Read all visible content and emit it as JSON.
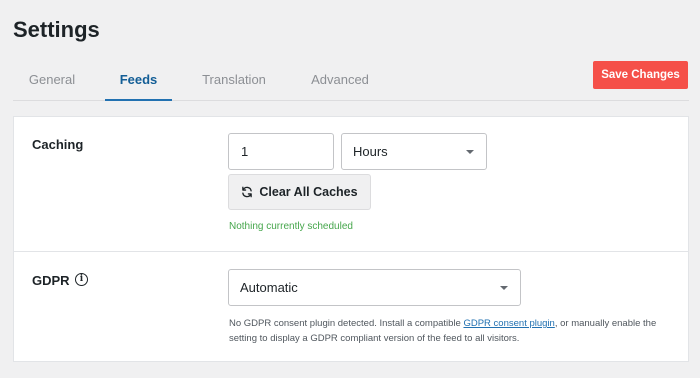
{
  "page": {
    "title": "Settings"
  },
  "tabs": [
    {
      "label": "General",
      "active": false
    },
    {
      "label": "Feeds",
      "active": true
    },
    {
      "label": "Translation",
      "active": false
    },
    {
      "label": "Advanced",
      "active": false
    }
  ],
  "header": {
    "save_label": "Save Changes"
  },
  "caching": {
    "label": "Caching",
    "interval_value": "1",
    "unit_selected": "Hours",
    "clear_button_label": "Clear All Caches",
    "status_text": "Nothing currently scheduled"
  },
  "gdpr": {
    "label": "GDPR",
    "info_icon_glyph": "i",
    "selected": "Automatic",
    "help_before": "No GDPR consent plugin detected. Install a compatible ",
    "help_link": "GDPR consent plugin",
    "help_after": ", or manually enable the setting to display a GDPR compliant version of the feed to all visitors."
  },
  "colors": {
    "accent": "#2271b1",
    "save_button": "#f55049",
    "status_green": "#46a64c",
    "background": "#f0f0f1"
  },
  "icons": {
    "refresh": "refresh-icon",
    "info": "info-icon",
    "dropdown": "chevron-down-icon"
  }
}
